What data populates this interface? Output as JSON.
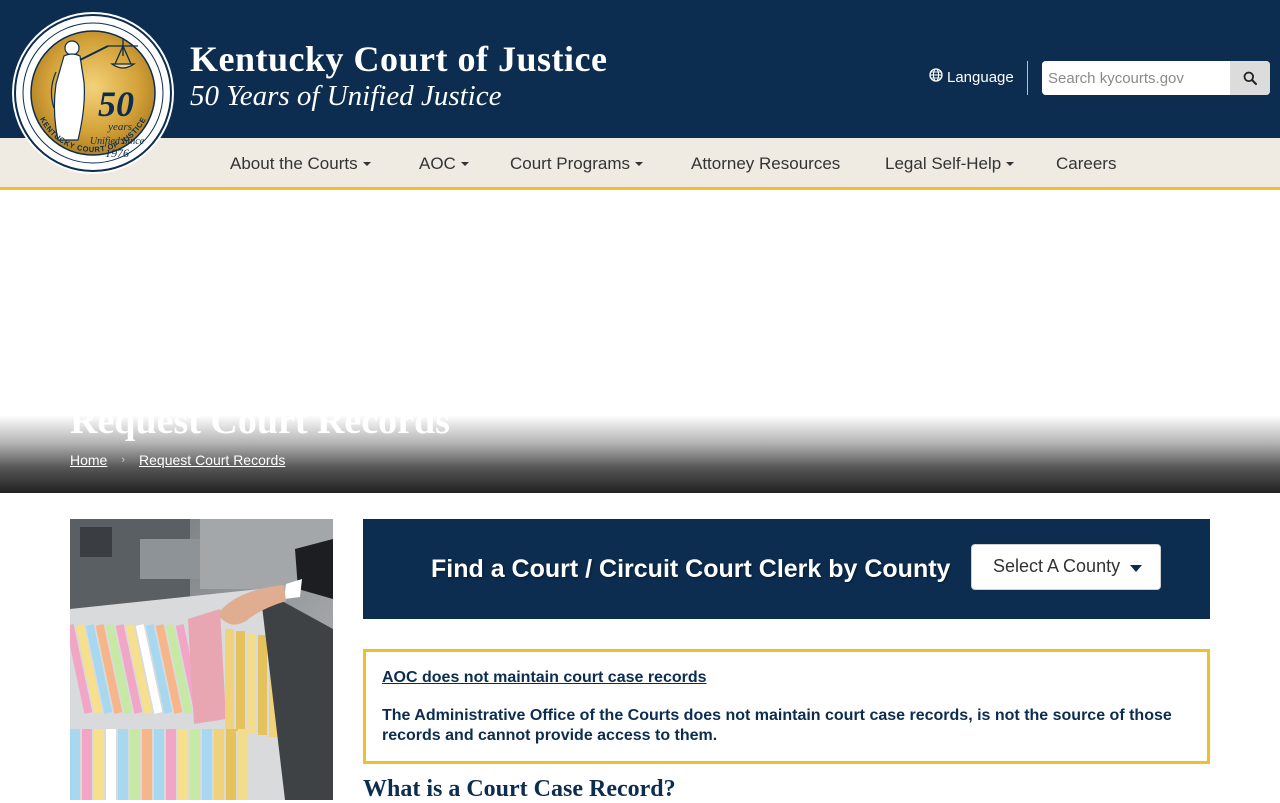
{
  "header": {
    "seal": {
      "big_number": "50",
      "years": "years",
      "unified_since": "Unified Since",
      "year": "1976",
      "ring_text": "KENTUCKY COURT OF JUSTICE"
    },
    "title": "Kentucky Court of Justice",
    "subtitle": "50 Years of Unified Justice",
    "language_label": "Language",
    "search_placeholder": "Search kycourts.gov"
  },
  "nav": {
    "items": [
      {
        "label": "About the Courts",
        "dropdown": true
      },
      {
        "label": "AOC",
        "dropdown": true
      },
      {
        "label": "Court Programs",
        "dropdown": true
      },
      {
        "label": "Attorney Resources",
        "dropdown": false
      },
      {
        "label": "Legal Self-Help",
        "dropdown": true
      },
      {
        "label": "Careers",
        "dropdown": false
      }
    ]
  },
  "hero": {
    "title": "Request Court Records",
    "breadcrumb": [
      "Home",
      "Request Court Records"
    ]
  },
  "county_finder": {
    "title": "Find a Court / Circuit Court Clerk by County",
    "select_label": "Select A County"
  },
  "notice": {
    "link_text": "AOC does not maintain court case records",
    "body": "The Administrative Office of the Courts does not maintain court case records, is not the source of those records and cannot provide access to them."
  },
  "section": {
    "heading": "What is a Court Case Record?"
  },
  "colors": {
    "navy": "#0c2d4f",
    "gold": "#f0c02c",
    "nav_bg": "#efebe3"
  }
}
